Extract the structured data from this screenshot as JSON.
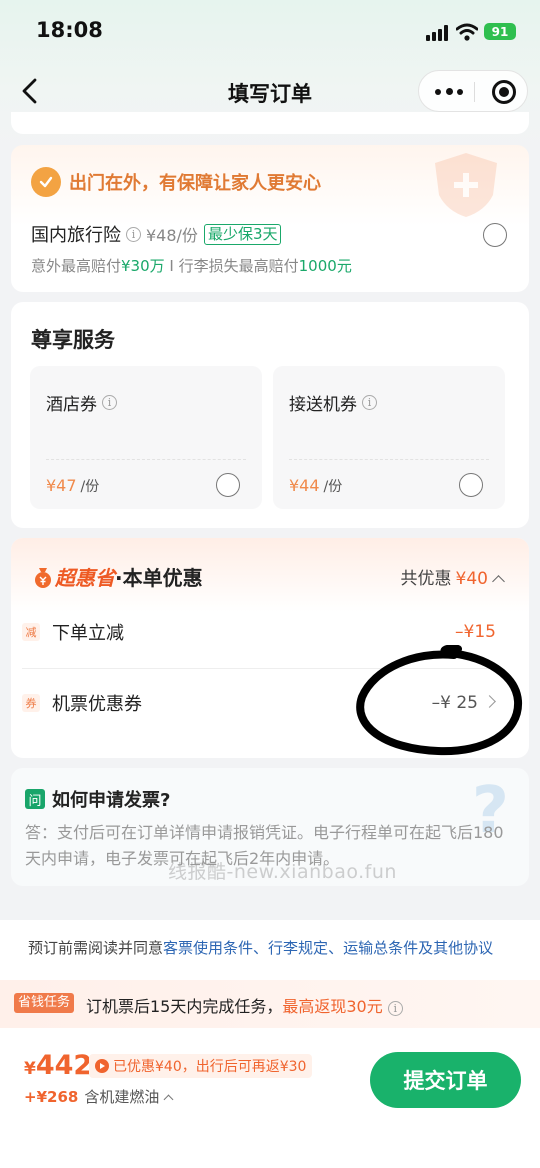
{
  "status_bar": {
    "time": "18:08",
    "battery": "91"
  },
  "nav": {
    "title": "填写订单"
  },
  "insurance": {
    "slogan": "出门在外，有保障让家人更安心",
    "name": "国内旅行险",
    "price": "¥48/份",
    "tag": "最少保3天",
    "sub_1": "意外最高赔付",
    "sub_1_amt": "¥30万",
    "sub_sep": " I ",
    "sub_2": "行李损失最高赔付",
    "sub_2_amt": "1000元"
  },
  "premium": {
    "title": "尊享服务",
    "items": [
      {
        "name": "酒店券",
        "price": "¥47",
        "unit": "/份"
      },
      {
        "name": "接送机券",
        "price": "¥44",
        "unit": "/份"
      }
    ]
  },
  "discount": {
    "brand": "超惠省",
    "title_rest": "·本单优惠",
    "total_label": "共优惠",
    "total_amount": "¥40",
    "rows": [
      {
        "badge": "减",
        "label": "下单立减",
        "value": "–¥15"
      },
      {
        "badge": "券",
        "label": "机票优惠券",
        "value": "–¥ 25"
      }
    ]
  },
  "invoice": {
    "badge": "问",
    "title": "如何申请发票?",
    "body": "答：支付后可在订单详情申请报销凭证。电子行程单可在起飞后180天内申请，电子发票可在起飞后2年内申请。",
    "watermark": "线报酷-new.xianbao.fun"
  },
  "agreement": {
    "prefix": "预订前需阅读并同意",
    "links": [
      "客票使用条件",
      "行李规定",
      "运输总条件及其他协议"
    ],
    "sep": "、"
  },
  "task": {
    "badge": "省钱任务",
    "text": "订机票后15天内完成任务，",
    "highlight": "最高返现30元"
  },
  "bottom": {
    "currency": "¥",
    "total": "442",
    "saved": "已优惠¥40，出行后可再返¥30",
    "fuel_amount": "+¥268",
    "fuel_label": "含机建燃油",
    "submit": "提交订单"
  },
  "colors": {
    "brand_green": "#19b26b",
    "accent_orange": "#f0642e"
  }
}
